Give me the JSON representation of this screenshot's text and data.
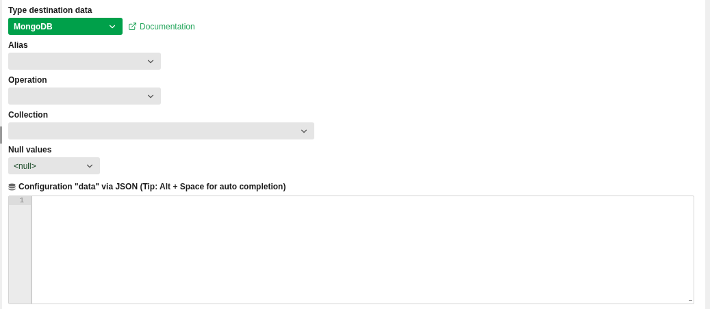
{
  "fields": [
    {
      "label": "Type destination data",
      "kind": "accent-select",
      "value": "MongoDB",
      "link": "Documentation"
    },
    {
      "label": "Alias",
      "kind": "select"
    },
    {
      "label": "Operation",
      "kind": "select"
    },
    {
      "label": "Collection",
      "kind": "select"
    },
    {
      "label": "Null values",
      "kind": "select",
      "value": "<null>"
    }
  ],
  "editor": {
    "title": "Configuration \"data\" via JSON (Tip: Alt + Space for auto completion)",
    "line_numbers": [
      "1"
    ]
  }
}
